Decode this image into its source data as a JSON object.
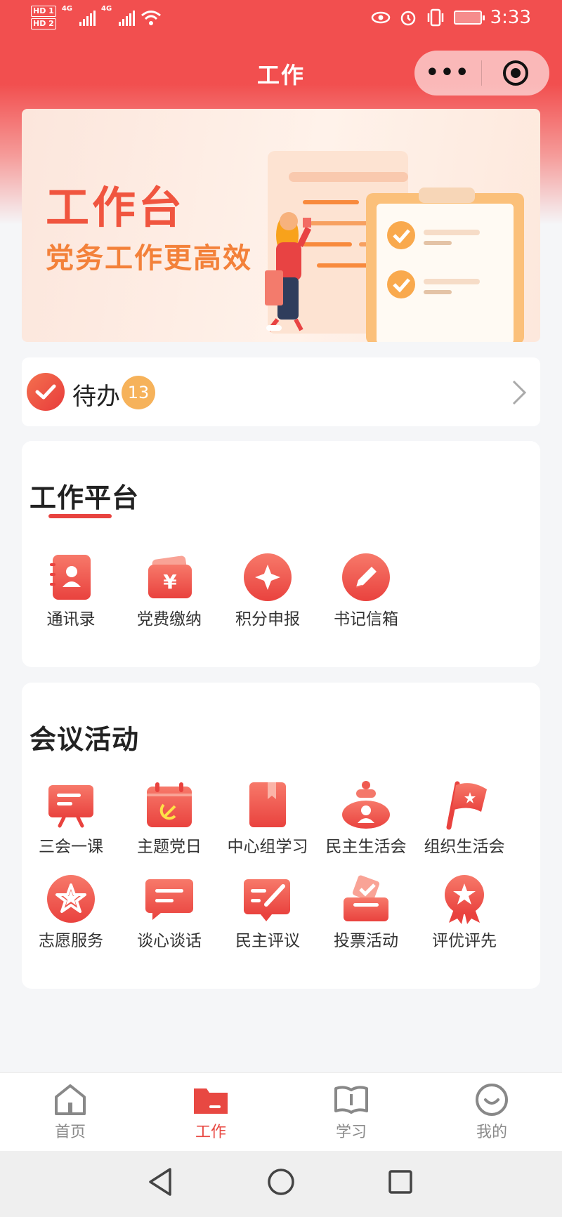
{
  "status_bar": {
    "hd1": "HD 1",
    "hd2": "HD 2",
    "net1": "4G",
    "net2": "4G",
    "time": "3:33"
  },
  "header": {
    "title": "工作",
    "menu_label": "•••"
  },
  "banner": {
    "title": "工作台",
    "subtitle": "党务工作更高效"
  },
  "todo": {
    "label": "待办",
    "count": "13"
  },
  "work_platform": {
    "title": "工作平台",
    "items": [
      {
        "label": "通讯录",
        "icon": "contacts-icon"
      },
      {
        "label": "党费缴纳",
        "icon": "party-fee-icon"
      },
      {
        "label": "积分申报",
        "icon": "points-icon"
      },
      {
        "label": "书记信箱",
        "icon": "mailbox-pen-icon"
      }
    ]
  },
  "meetings": {
    "title": "会议活动",
    "items": [
      {
        "label": "三会一课",
        "icon": "presentation-board-icon"
      },
      {
        "label": "主题党日",
        "icon": "party-day-calendar-icon"
      },
      {
        "label": "中心组学习",
        "icon": "book-icon"
      },
      {
        "label": "民主生活会",
        "icon": "meeting-person-icon"
      },
      {
        "label": "组织生活会",
        "icon": "flag-icon"
      },
      {
        "label": "志愿服务",
        "icon": "star-circle-icon"
      },
      {
        "label": "谈心谈话",
        "icon": "chat-bubble-icon"
      },
      {
        "label": "民主评议",
        "icon": "review-edit-icon"
      },
      {
        "label": "投票活动",
        "icon": "ballot-box-icon"
      },
      {
        "label": "评优评先",
        "icon": "award-medal-icon"
      }
    ]
  },
  "tabbar": {
    "items": [
      {
        "label": "首页",
        "icon": "home-icon"
      },
      {
        "label": "工作",
        "icon": "folder-icon",
        "active": true
      },
      {
        "label": "学习",
        "icon": "open-book-icon"
      },
      {
        "label": "我的",
        "icon": "smile-profile-icon"
      }
    ]
  },
  "colors": {
    "brand_red": "#e8433f",
    "badge_orange": "#f6b25a",
    "header_red": "#f24f4f"
  }
}
